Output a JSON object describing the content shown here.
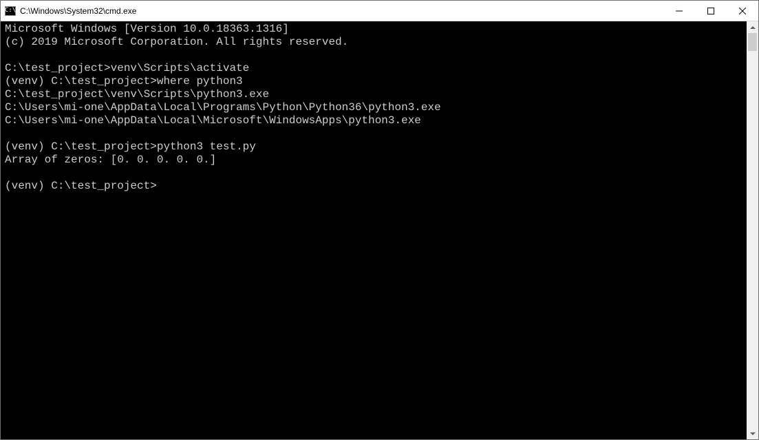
{
  "window": {
    "title": "C:\\Windows\\System32\\cmd.exe",
    "icon_label": "C:\\"
  },
  "terminal": {
    "lines": [
      "Microsoft Windows [Version 10.0.18363.1316]",
      "(c) 2019 Microsoft Corporation. All rights reserved.",
      "",
      "C:\\test_project>venv\\Scripts\\activate",
      "(venv) C:\\test_project>where python3",
      "C:\\test_project\\venv\\Scripts\\python3.exe",
      "C:\\Users\\mi-one\\AppData\\Local\\Programs\\Python\\Python36\\python3.exe",
      "C:\\Users\\mi-one\\AppData\\Local\\Microsoft\\WindowsApps\\python3.exe",
      "",
      "(venv) C:\\test_project>python3 test.py",
      "Array of zeros: [0. 0. 0. 0. 0.]",
      "",
      "(venv) C:\\test_project>"
    ]
  }
}
